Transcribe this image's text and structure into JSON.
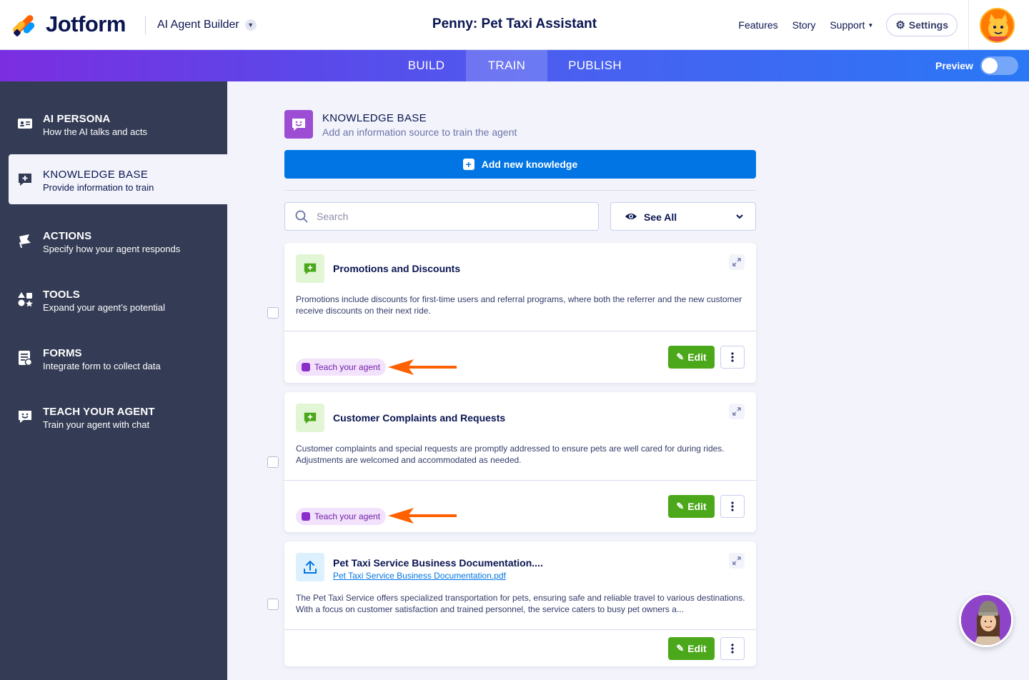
{
  "header": {
    "logo_text": "Jotform",
    "builder_label": "AI Agent Builder",
    "app_title": "Penny: Pet Taxi Assistant",
    "nav": [
      "Features",
      "Story",
      "Support"
    ],
    "settings_label": "Settings"
  },
  "tabs": {
    "items": [
      {
        "label": "BUILD",
        "active": false
      },
      {
        "label": "TRAIN",
        "active": true
      },
      {
        "label": "PUBLISH",
        "active": false
      }
    ],
    "preview_label": "Preview"
  },
  "sidebar": {
    "items": [
      {
        "title": "AI PERSONA",
        "subtitle": "How the AI talks and acts",
        "icon": "id-card-icon"
      },
      {
        "title": "KNOWLEDGE BASE",
        "subtitle": "Provide information to train",
        "icon": "chat-plus-icon",
        "active": true
      },
      {
        "title": "ACTIONS",
        "subtitle": "Specify how your agent responds",
        "icon": "flag-icon"
      },
      {
        "title": "TOOLS",
        "subtitle": "Expand your agent’s potential",
        "icon": "shapes-icon"
      },
      {
        "title": "FORMS",
        "subtitle": "Integrate form to collect data",
        "icon": "form-icon"
      },
      {
        "title": "TEACH YOUR AGENT",
        "subtitle": "Train your agent with chat",
        "icon": "smile-chat-icon"
      }
    ]
  },
  "main": {
    "title": "KNOWLEDGE BASE",
    "subtitle": "Add an information source to train the agent",
    "add_button": "Add new knowledge",
    "search_placeholder": "Search",
    "filter_label": "See All",
    "edit_label": "Edit",
    "teach_label": "Teach your agent",
    "cards": [
      {
        "title": "Promotions and Discounts",
        "description": "Promotions include discounts for first-time users and referral programs, where both the referrer and the new customer receive discounts on their next ride."
      },
      {
        "title": "Customer Complaints and Requests",
        "description": "Customer complaints and special requests are promptly addressed to ensure pets are well cared for during rides. Adjustments are welcomed and accommodated as needed."
      },
      {
        "title": "Pet Taxi Service Business Documentation....",
        "link": "Pet Taxi Service Business Documentation.pdf",
        "description": "The Pet Taxi Service offers specialized transportation for pets, ensuring safe and reliable travel to various destinations. With a focus on customer satisfaction and trained personnel, the service caters to busy pet owners a..."
      }
    ]
  },
  "colors": {
    "brand_blue": "#0075e3",
    "edit_green": "#4ca81b",
    "sidebar_bg": "#343c55",
    "annotation_arrow": "#ff6100"
  }
}
